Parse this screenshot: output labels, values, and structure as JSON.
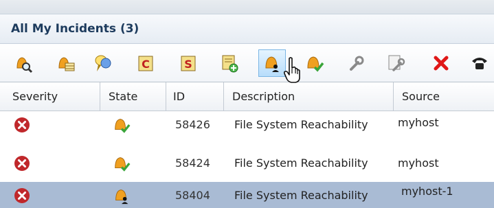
{
  "panel": {
    "title": "All My Incidents (3)"
  },
  "toolbar": {
    "buttons": [
      {
        "icon": "bell-search-icon",
        "name": "toolbar-view-button"
      },
      {
        "icon": "bell-table-icon",
        "name": "toolbar-details-button"
      },
      {
        "icon": "balloon-comment-icon",
        "name": "toolbar-comment-button"
      },
      {
        "icon": "c-clipboard-icon",
        "name": "toolbar-c-button"
      },
      {
        "icon": "s-clipboard-icon",
        "name": "toolbar-s-button"
      },
      {
        "icon": "document-add-icon",
        "name": "toolbar-add-button"
      },
      {
        "icon": "bell-user-icon",
        "name": "toolbar-assign-button",
        "active": true
      },
      {
        "icon": "bell-check-icon",
        "name": "toolbar-acknowledge-button"
      },
      {
        "icon": "wrench-icon",
        "name": "toolbar-manage-button"
      },
      {
        "icon": "document-wrench-icon",
        "name": "toolbar-edit-button"
      },
      {
        "icon": "red-x-icon",
        "name": "toolbar-delete-button"
      },
      {
        "icon": "telephone-icon",
        "name": "toolbar-call-button"
      }
    ]
  },
  "table": {
    "columns": {
      "severity": "Severity",
      "state": "State",
      "id": "ID",
      "description": "Description",
      "source": "Source"
    },
    "rows": [
      {
        "severity_icon": "critical-x-icon",
        "state_icon": "bell-check-icon",
        "id": "58426",
        "description": "File System Reachability",
        "source": "myhost",
        "selected": false
      },
      {
        "severity_icon": "critical-x-icon",
        "state_icon": "bell-check-icon",
        "id": "58424",
        "description": "File System Reachability",
        "source": "myhost",
        "selected": false
      },
      {
        "severity_icon": "critical-x-icon",
        "state_icon": "bell-user-icon",
        "id": "58404",
        "description": "File System Reachability",
        "source": "myhost-1",
        "selected": true
      }
    ]
  },
  "colors": {
    "title": "#1d3b5d",
    "selected_row": "#a9bbd4",
    "critical": "#c0282b",
    "bell": "#f0a020",
    "check": "#3aa53a"
  }
}
